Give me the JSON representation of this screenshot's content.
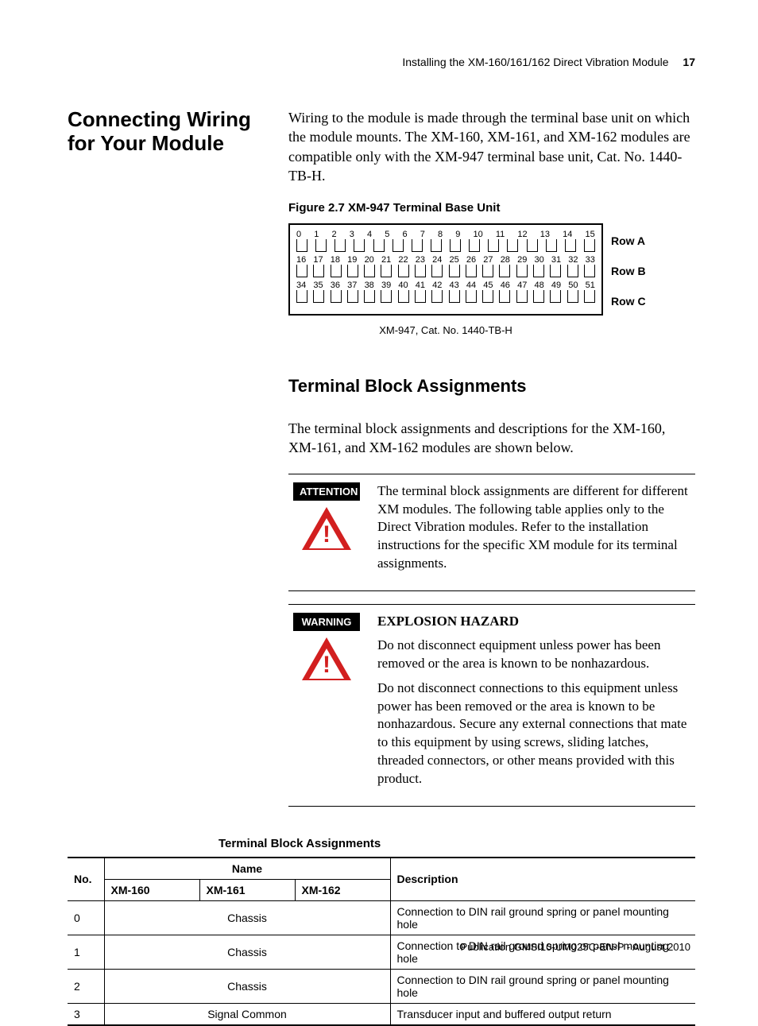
{
  "running_head": {
    "text": "Installing the XM-160/161/162 Direct Vibration Module",
    "page": "17"
  },
  "section": {
    "side_heading": "Connecting Wiring for Your Module",
    "intro": "Wiring to the module is made through the terminal base unit on which the module mounts. The XM-160, XM-161, and XM-162 modules are compatible only with the XM-947 terminal base unit, Cat. No. 1440-TB-H."
  },
  "figure": {
    "caption": "Figure 2.7 XM-947 Terminal Base Unit",
    "sub_caption": "XM-947, Cat. No. 1440-TB-H",
    "row_labels": [
      "Row A",
      "Row B",
      "Row C"
    ],
    "rows": {
      "a": [
        "0",
        "1",
        "2",
        "3",
        "4",
        "5",
        "6",
        "7",
        "8",
        "9",
        "10",
        "11",
        "12",
        "13",
        "14",
        "15"
      ],
      "b": [
        "16",
        "17",
        "18",
        "19",
        "20",
        "21",
        "22",
        "23",
        "24",
        "25",
        "26",
        "27",
        "28",
        "29",
        "30",
        "31",
        "32",
        "33"
      ],
      "c": [
        "34",
        "35",
        "36",
        "37",
        "38",
        "39",
        "40",
        "41",
        "42",
        "43",
        "44",
        "45",
        "46",
        "47",
        "48",
        "49",
        "50",
        "51"
      ]
    }
  },
  "subsection": {
    "heading": "Terminal Block Assignments",
    "intro": "The terminal block assignments and descriptions for the XM-160, XM-161, and XM-162 modules are shown below."
  },
  "callouts": {
    "attention": {
      "label": "ATTENTION",
      "text": "The terminal block assignments are different for different XM modules. The following table applies only to the Direct Vibration modules. Refer to the installation instructions for the specific XM module for its terminal assignments."
    },
    "warning": {
      "label": "WARNING",
      "lead": "EXPLOSION HAZARD",
      "p1": "Do not disconnect equipment unless power has been removed or the area is known to be nonhazardous.",
      "p2": "Do not disconnect connections to this equipment unless power has been removed or the area is known to be nonhazardous. Secure any external connections that mate to this equipment by using screws, sliding latches, threaded connectors, or other means provided with this product."
    }
  },
  "table": {
    "title": "Terminal Block Assignments",
    "head": {
      "no": "No.",
      "name_group": "Name",
      "xm160": "XM-160",
      "xm161": "XM-161",
      "xm162": "XM-162",
      "desc": "Description"
    },
    "rows": [
      {
        "no": "0",
        "name": "Chassis",
        "desc": "Connection to DIN rail ground spring or panel mounting hole"
      },
      {
        "no": "1",
        "name": "Chassis",
        "desc": "Connection to DIN rail ground spring or panel mounting hole"
      },
      {
        "no": "2",
        "name": "Chassis",
        "desc": "Connection to DIN rail ground spring or panel mounting hole"
      },
      {
        "no": "3",
        "name": "Signal Common",
        "desc": "Transducer input and buffered output return"
      }
    ]
  },
  "footer": "Publication GMSI10-UM025C-EN-P - August 2010"
}
